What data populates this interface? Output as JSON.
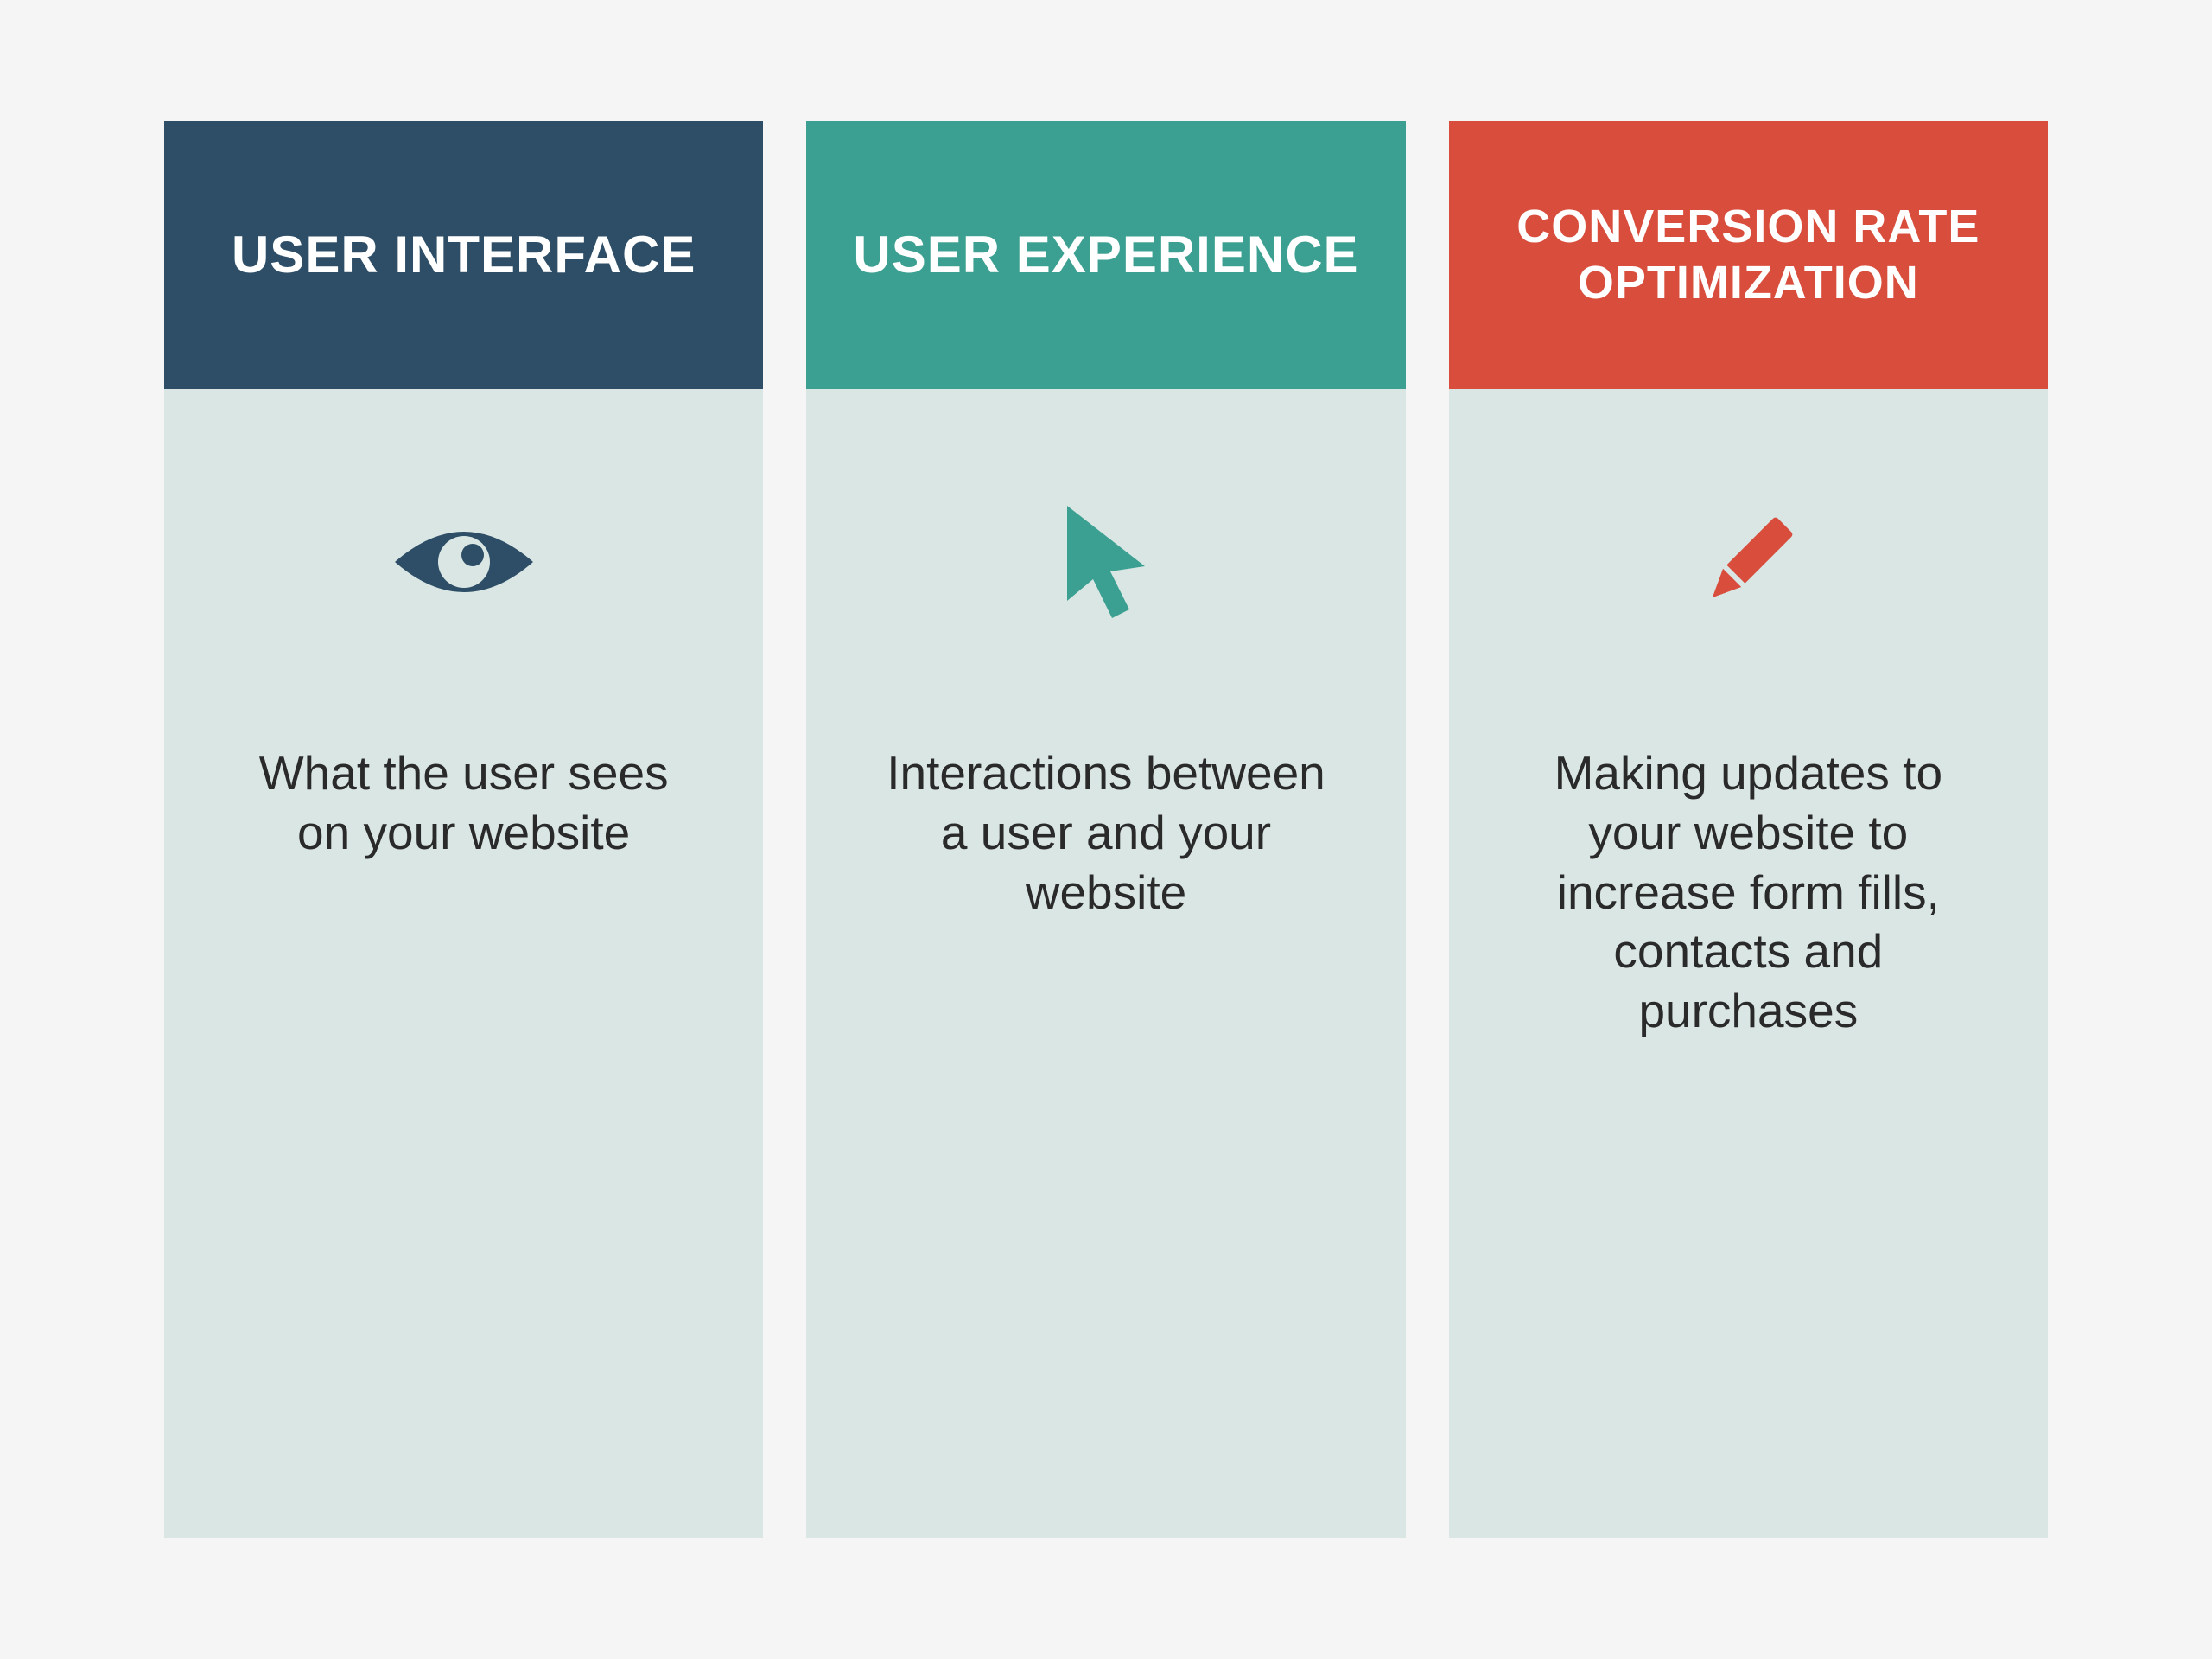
{
  "columns": [
    {
      "title": "USER INTERFACE",
      "icon": "eye",
      "description": "What the user sees on your website",
      "header_color": "#2d4e66",
      "icon_color": "#2d4e66"
    },
    {
      "title": "USER EXPERIENCE",
      "icon": "cursor",
      "description": "Interactions between a user and your website",
      "header_color": "#3ba091",
      "icon_color": "#3ba091"
    },
    {
      "title": "CONVERSION RATE OPTIMIZATION",
      "icon": "pencil",
      "description": "Making updates to your website to increase form fills, contacts and purchases",
      "header_color": "#d94d3c",
      "icon_color": "#d94d3c"
    }
  ]
}
